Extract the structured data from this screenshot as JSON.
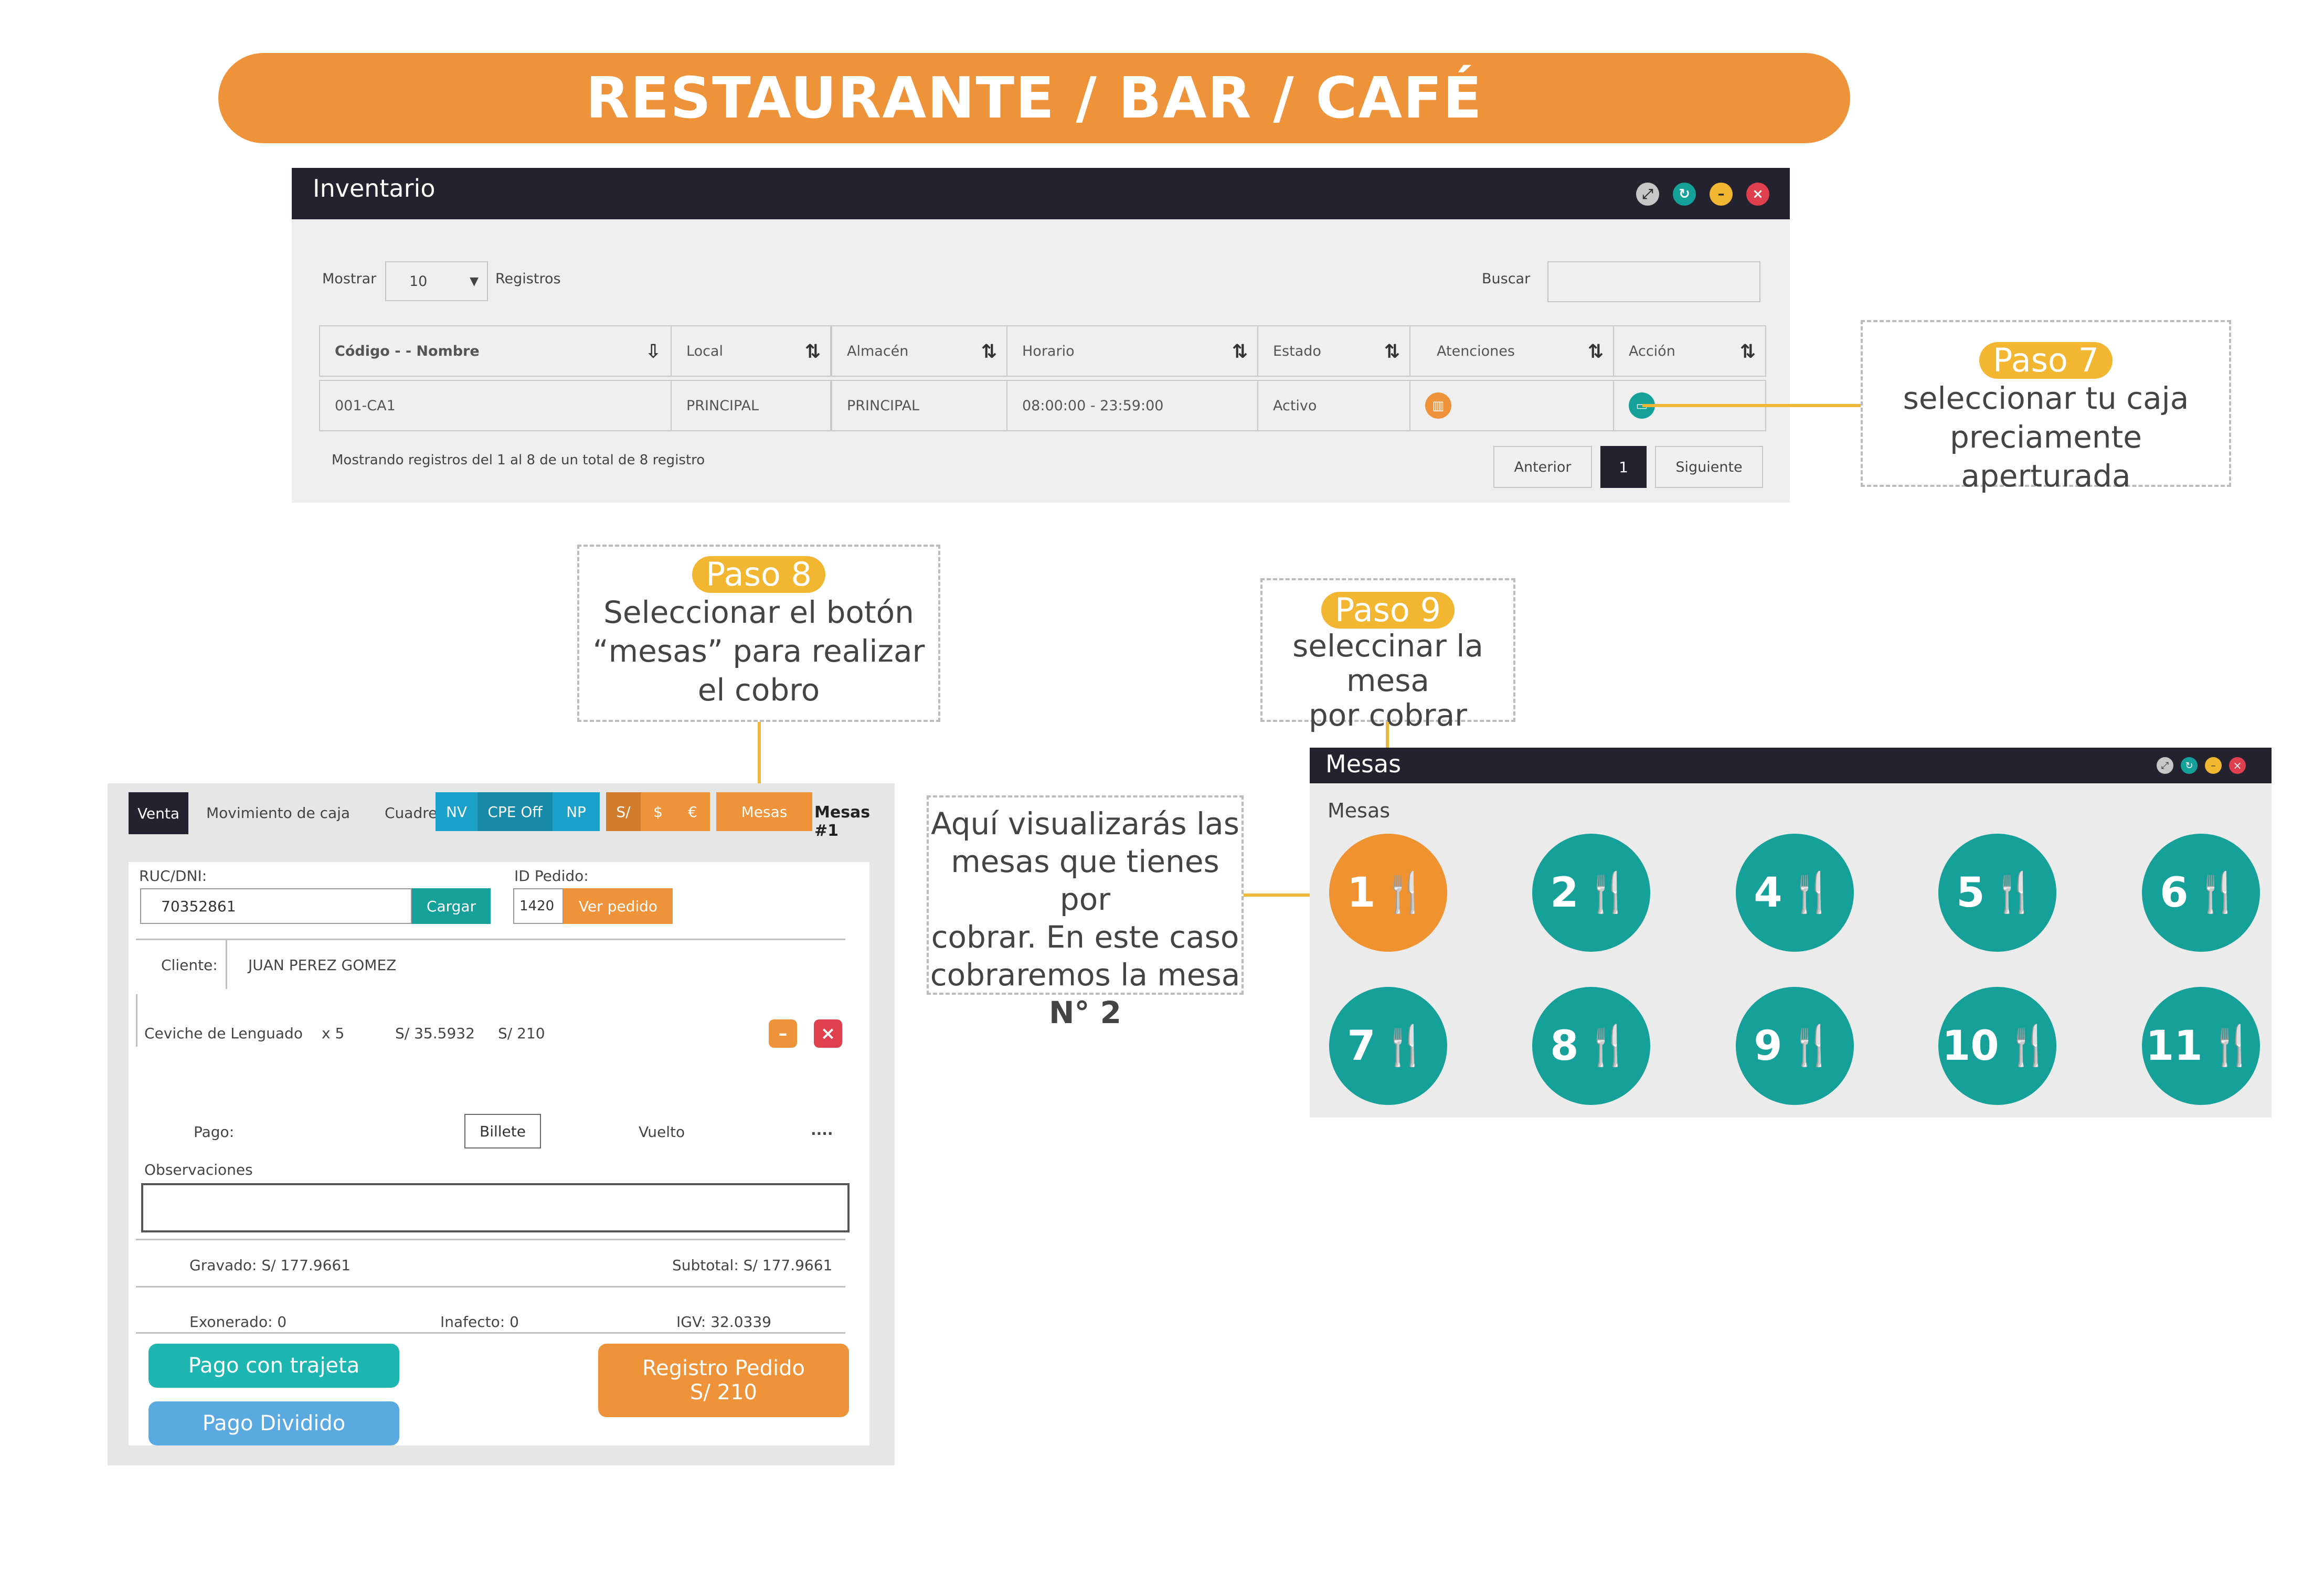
{
  "banner": {
    "title": "RESTAURANTE / BAR / CAFÉ"
  },
  "inventory": {
    "title": "Inventario",
    "show_label": "Mostrar",
    "show_value": "10",
    "records_label": "Registros",
    "search_label": "Buscar",
    "search_value": "",
    "columns": [
      "Código - - Nombre",
      "Local",
      "Almacén",
      "Horario",
      "Estado",
      "Atenciones",
      "Acción"
    ],
    "row": {
      "codigo": "001-CA1",
      "local": "PRINCIPAL",
      "almacen": "PRINCIPAL",
      "horario": "08:00:00 - 23:59:00",
      "estado": "Activo"
    },
    "footer_text": "Mostrando registros del 1 al 8 de un total de 8 registro",
    "prev_label": "Anterior",
    "page": "1",
    "next_label": "Siguiente"
  },
  "steps": {
    "paso7": {
      "badge": "Paso 7",
      "line1": "seleccionar tu caja",
      "line2": "preciamente aperturada"
    },
    "paso8": {
      "badge": "Paso 8",
      "line1": "Seleccionar el botón",
      "line2": "“mesas” para realizar",
      "line3": "el cobro"
    },
    "paso9": {
      "badge": "Paso 9",
      "line1": "seleccinar la mesa",
      "line2": "por cobrar"
    },
    "info": {
      "line1": "Aquí visualizarás las",
      "line2": "mesas que tienes por",
      "line3": "cobrar. En este caso",
      "line4": "cobraremos la mesa",
      "line5": "N° 2"
    }
  },
  "sale": {
    "tab_venta": "Venta",
    "tab_movimiento": "Movimiento de caja",
    "tab_cuadre": "Cuadre",
    "btn_nv": "NV",
    "btn_cpe": "CPE Off",
    "btn_np": "NP",
    "cur_sol": "S/",
    "cur_usd": "$",
    "cur_eur": "€",
    "btn_mesas": "Mesas",
    "mesa_label": "Mesas #1",
    "ruc_label": "RUC/DNI:",
    "ruc_value": "70352861",
    "cargar": "Cargar",
    "pedido_label": "ID Pedido:",
    "pedido_value": "1420",
    "ver_pedido": "Ver pedido",
    "cliente_label": "Cliente:",
    "cliente_value": "JUAN PEREZ GOMEZ",
    "item": {
      "name": "Ceviche de Lenguado",
      "qty": "x 5",
      "unit": "S/ 35.5932",
      "total": "S/ 210"
    },
    "pago_label": "Pago:",
    "pago_value": "Billete",
    "vuelto_label": "Vuelto",
    "vuelto_value": "....",
    "obs_label": "Observaciones",
    "obs_value": "",
    "gravado": "Gravado: S/ 177.9661",
    "subtotal": "Subtotal: S/ 177.9661",
    "exonerado": "Exonerado: 0",
    "inafecto": "Inafecto: 0",
    "igv": "IGV: 32.0339",
    "btn_tarjeta": "Pago con trajeta",
    "btn_dividido": "Pago Dividido",
    "btn_registro1": "Registro Pedido",
    "btn_registro2": "S/ 210"
  },
  "mesas": {
    "title": "Mesas",
    "subtitle": "Mesas",
    "tables": [
      "1",
      "2",
      "4",
      "5",
      "6",
      "7",
      "8",
      "9",
      "10",
      "11"
    ],
    "selected": "1"
  },
  "colors": {
    "orange": "#ef933a",
    "teal": "#16a09a",
    "dark": "#23222e",
    "yellow": "#f2b631",
    "red": "#e0404d",
    "blue": "#5aa9e0"
  }
}
